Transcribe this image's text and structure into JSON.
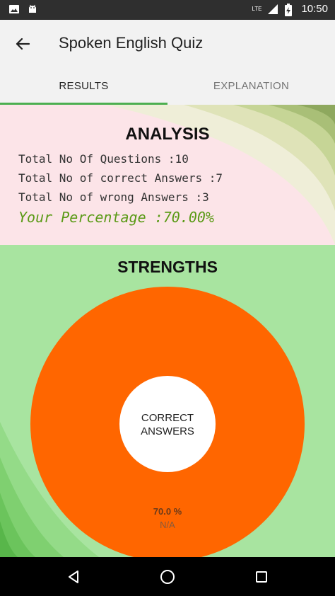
{
  "status_bar": {
    "time": "10:50",
    "network_label": "LTE",
    "left_icons": [
      "image-icon",
      "android-icon"
    ],
    "right_icons": [
      "signal-icon",
      "battery-icon"
    ]
  },
  "app_bar": {
    "title": "Spoken English Quiz",
    "back_icon": "arrow-back-icon"
  },
  "tabs": [
    {
      "label": "RESULTS",
      "active": true
    },
    {
      "label": "EXPLANATION",
      "active": false
    }
  ],
  "analysis": {
    "title": "ANALYSIS",
    "total_questions": "Total No Of Questions :10",
    "correct_answers": "Total No of correct Answers :7",
    "wrong_answers": "Total No of wrong Answers :3",
    "percentage": "Your Percentage :70.00%"
  },
  "strengths": {
    "title": "STRENGTHS"
  },
  "chart_data": {
    "type": "pie",
    "donut": true,
    "center_label": "CORRECT\nANSWERS",
    "slices": [
      {
        "label": "N/A",
        "value": 70.0,
        "value_label": "70.0 %",
        "color": "#ff6600"
      }
    ]
  },
  "colors": {
    "tab_indicator": "#4caf50",
    "percentage_text": "#5a9a16",
    "chart_slice": "#ff6600",
    "analysis_bg": "#fce4e8",
    "strengths_bg": "#a8e4a0"
  },
  "nav_bar": {
    "buttons": [
      "back-triangle-icon",
      "home-circle-icon",
      "recents-square-icon"
    ]
  }
}
